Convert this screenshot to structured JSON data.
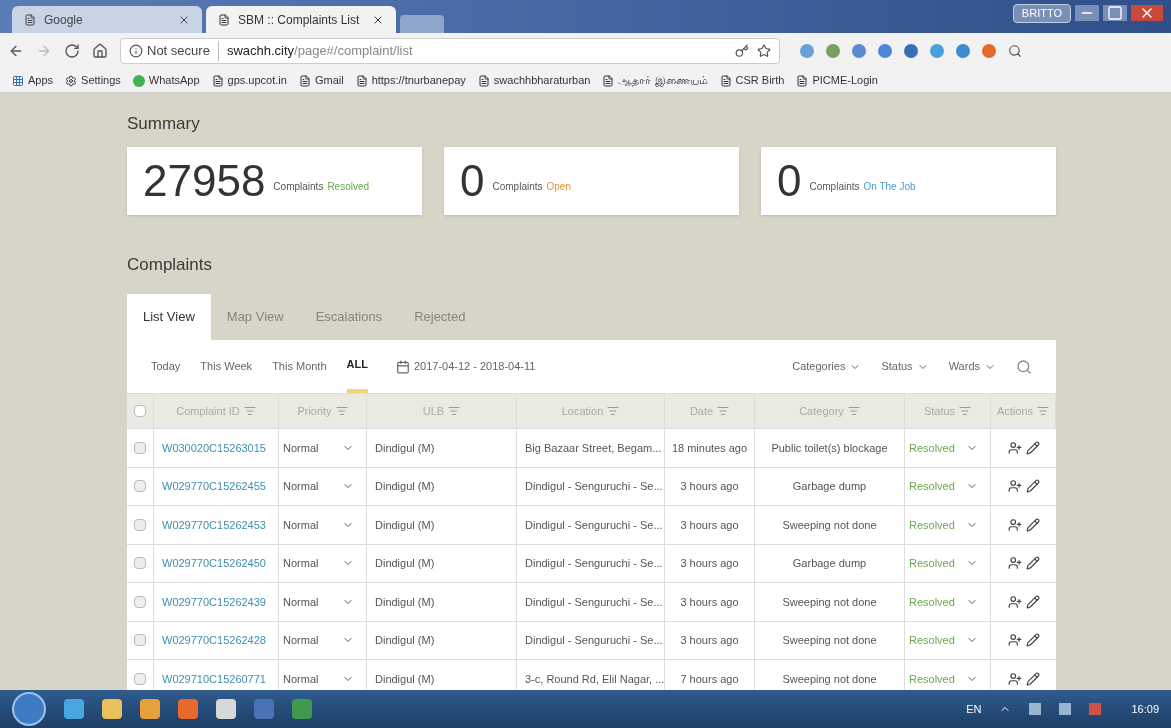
{
  "browser": {
    "tabs": [
      {
        "label": "Google",
        "selected": false
      },
      {
        "label": "SBM :: Complaints List",
        "selected": true
      }
    ],
    "user": "BRITTO",
    "security": "Not secure",
    "url_host": "swachh.city",
    "url_path": "/page#/complaint/list",
    "bookmarks": [
      "Apps",
      "Settings",
      "WhatsApp",
      "gps.upcot.in",
      "Gmail",
      "https://tnurbanepay",
      "swachhbharaturban",
      "ஆதார் இணையம்",
      "CSR Birth",
      "PICME-Login"
    ]
  },
  "summary": {
    "title": "Summary",
    "cards": [
      {
        "count": "27958",
        "label": "Complaints",
        "status": "Resolved",
        "color": "#6aa84f"
      },
      {
        "count": "0",
        "label": "Complaints",
        "status": "Open",
        "color": "#e69138"
      },
      {
        "count": "0",
        "label": "Complaints",
        "status": "On The Job",
        "color": "#4a9fd0"
      }
    ]
  },
  "complaints": {
    "title": "Complaints",
    "tabs": [
      {
        "label": "List View",
        "selected": true
      },
      {
        "label": "Map View",
        "selected": false
      },
      {
        "label": "Escalations",
        "selected": false
      },
      {
        "label": "Rejected",
        "selected": false
      }
    ],
    "periods": [
      {
        "label": "Today",
        "selected": false
      },
      {
        "label": "This Week",
        "selected": false
      },
      {
        "label": "This Month",
        "selected": false
      },
      {
        "label": "ALL",
        "selected": true
      }
    ],
    "date_range": "2017-04-12 - 2018-04-11",
    "filters": [
      "Categories",
      "Status",
      "Wards"
    ],
    "select_all_checked": false,
    "columns": [
      "Complaint ID",
      "Priority",
      "ULB",
      "Location",
      "Date",
      "Category",
      "Status",
      "Actions"
    ],
    "rows": [
      {
        "id": "W030020C15263015",
        "priority": "Normal",
        "ulb": "Dindigul (M)",
        "location": "Big Bazaar Street, Begam...",
        "date": "18 minutes ago",
        "category": "Public toilet(s) blockage",
        "status": "Resolved",
        "checked": false
      },
      {
        "id": "W029770C15262455",
        "priority": "Normal",
        "ulb": "Dindigul (M)",
        "location": "Dindigul - Senguruchi - Se...",
        "date": "3 hours ago",
        "category": "Garbage dump",
        "status": "Resolved",
        "checked": false
      },
      {
        "id": "W029770C15262453",
        "priority": "Normal",
        "ulb": "Dindigul (M)",
        "location": "Dindigul - Senguruchi - Se...",
        "date": "3 hours ago",
        "category": "Sweeping not done",
        "status": "Resolved",
        "checked": false
      },
      {
        "id": "W029770C15262450",
        "priority": "Normal",
        "ulb": "Dindigul (M)",
        "location": "Dindigul - Senguruchi - Se...",
        "date": "3 hours ago",
        "category": "Garbage dump",
        "status": "Resolved",
        "checked": false
      },
      {
        "id": "W029770C15262439",
        "priority": "Normal",
        "ulb": "Dindigul (M)",
        "location": "Dindigul - Senguruchi - Se...",
        "date": "3 hours ago",
        "category": "Sweeping not done",
        "status": "Resolved",
        "checked": false
      },
      {
        "id": "W029770C15262428",
        "priority": "Normal",
        "ulb": "Dindigul (M)",
        "location": "Dindigul - Senguruchi - Se...",
        "date": "3 hours ago",
        "category": "Sweeping not done",
        "status": "Resolved",
        "checked": false
      },
      {
        "id": "W029710C15260771",
        "priority": "Normal",
        "ulb": "Dindigul (M)",
        "location": "3-c, Round Rd, Elil Nagar, ...",
        "date": "7 hours ago",
        "category": "Sweeping not done",
        "status": "Resolved",
        "checked": false
      }
    ]
  },
  "taskbar": {
    "language": "EN",
    "clock": "16:09"
  }
}
